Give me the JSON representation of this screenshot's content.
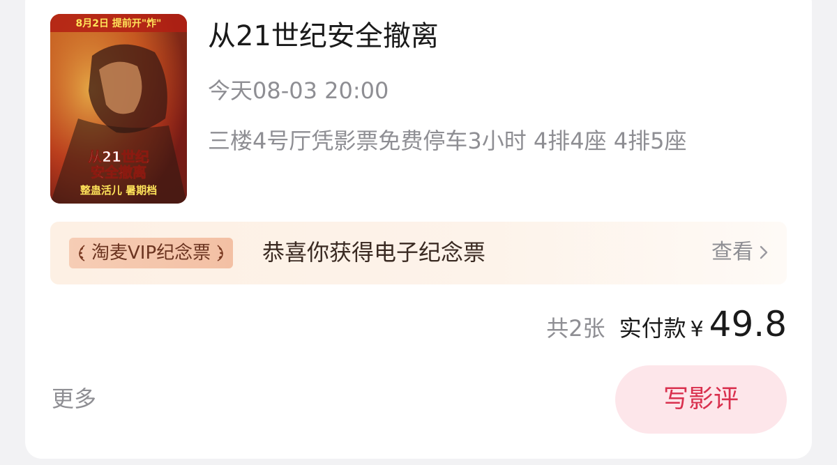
{
  "movie": {
    "title": "从21世纪安全撤离",
    "showtime": "今天08-03 20:00",
    "hall_and_seats": "三楼4号厅凭影票免费停车3小时 4排4座 4排5座",
    "poster": {
      "top_text": "8月2日 提前开\"炸\"",
      "logo_line1": "从21世纪",
      "logo_line2": "安全撤离",
      "bottom_text": "整蛊活儿 暑期档"
    }
  },
  "souvenir": {
    "badge": "淘麦VIP纪念票",
    "message": "恭喜你获得电子纪念票",
    "view_label": "查看"
  },
  "order": {
    "ticket_count": "共2张",
    "paid_label": "实付款",
    "currency": "¥",
    "amount": "49.8"
  },
  "actions": {
    "more": "更多",
    "review": "写影评"
  },
  "colors": {
    "review_button_bg": "#fde6ea",
    "review_button_text": "#d9304e",
    "badge_bg": "#f6cdb5",
    "banner_bg": "#fdf0e4"
  },
  "icons": {
    "laurel": "laurel-icon",
    "chevron": "chevron-right-icon"
  }
}
